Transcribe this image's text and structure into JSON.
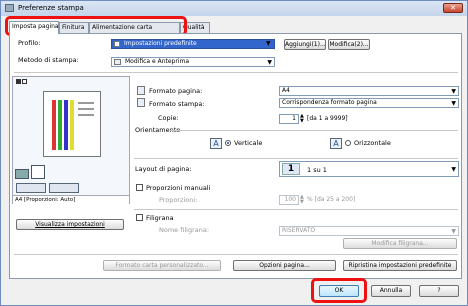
{
  "window": {
    "title": "Preferenze stampa"
  },
  "tabs": [
    "Imposta pagina",
    "Finitura",
    "Alimentazione carta",
    "Qualità"
  ],
  "profile": {
    "label": "Profilo:",
    "value": "Impostazioni predefinite",
    "add_button": "Aggiungi(1)...",
    "edit_button": "Modifica(2)..."
  },
  "output_method": {
    "label": "Metodo di stampa:",
    "value": "Modifica e Anteprima"
  },
  "preview": {
    "caption": "A4 [Proporzioni: Auto]",
    "view_settings_button": "Visualizza impostazioni"
  },
  "page_size": {
    "label": "Formato pagina:",
    "value": "A4"
  },
  "output_size": {
    "label": "Formato stampa:",
    "value": "Corrispondenza formato pagina"
  },
  "copies": {
    "label": "Copie:",
    "value": "1",
    "range": "[da 1 a 9999]"
  },
  "orientation": {
    "label": "Orientamento",
    "portrait": "Verticale",
    "landscape": "Orizzontale",
    "portrait_letter": "A",
    "landscape_letter": "A"
  },
  "layout": {
    "label": "Layout di pagina:",
    "value": "1 su 1",
    "number": "1"
  },
  "manual_scaling": {
    "label": "Proporzioni manuali",
    "scaling_label": "Proporzioni:",
    "value": "100",
    "range": "% [da 25 a 200]"
  },
  "watermark": {
    "label": "Filigrana",
    "name_label": "Nome filigrana:",
    "value": "RISERVATO",
    "edit_button": "Modifica filigrana..."
  },
  "bottom_buttons": {
    "custom_paper": "Formato carta personalizzato...",
    "page_options": "Opzioni pagina...",
    "restore_defaults": "Ripristina impostazioni predefinite"
  },
  "dialog_buttons": {
    "ok": "OK",
    "cancel": "Annulla",
    "help": "?"
  }
}
